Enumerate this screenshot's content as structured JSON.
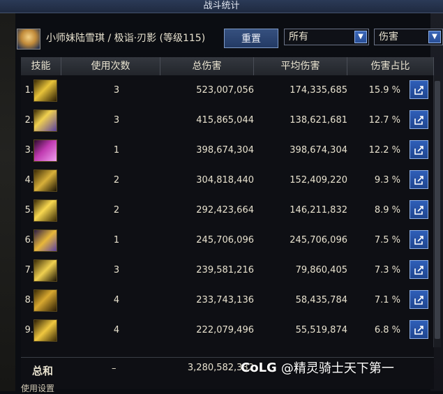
{
  "window": {
    "title": "战斗统计"
  },
  "header": {
    "character": "小师妹陆雪琪 / 极诣·刃影 (等级115)",
    "reset_label": "重置",
    "filter_target": "所有",
    "filter_metric": "伤害"
  },
  "table": {
    "columns": [
      "技能",
      "使用次数",
      "总伤害",
      "平均伤害",
      "伤害占比"
    ],
    "rows": [
      {
        "idx": "1.",
        "uses": "3",
        "total": "523,007,056",
        "avg": "174,335,685",
        "pct": "15.9 %"
      },
      {
        "idx": "2.",
        "uses": "3",
        "total": "415,865,044",
        "avg": "138,621,681",
        "pct": "12.7 %"
      },
      {
        "idx": "3.",
        "uses": "1",
        "total": "398,674,304",
        "avg": "398,674,304",
        "pct": "12.2 %"
      },
      {
        "idx": "4.",
        "uses": "2",
        "total": "304,818,440",
        "avg": "152,409,220",
        "pct": "9.3 %"
      },
      {
        "idx": "5.",
        "uses": "2",
        "total": "292,423,664",
        "avg": "146,211,832",
        "pct": "8.9 %"
      },
      {
        "idx": "6.",
        "uses": "1",
        "total": "245,706,096",
        "avg": "245,706,096",
        "pct": "7.5 %"
      },
      {
        "idx": "7.",
        "uses": "3",
        "total": "239,581,216",
        "avg": "79,860,405",
        "pct": "7.3 %"
      },
      {
        "idx": "8.",
        "uses": "4",
        "total": "233,743,136",
        "avg": "58,435,784",
        "pct": "7.1 %"
      },
      {
        "idx": "9.",
        "uses": "4",
        "total": "222,079,496",
        "avg": "55,519,874",
        "pct": "6.8 %"
      }
    ],
    "total_label": "总和",
    "total_uses": "–",
    "total_value": "3,280,582,332"
  },
  "bottom_tab": "使用设置",
  "watermark": {
    "logo": "CoLG",
    "text": "@精灵骑士天下第一"
  },
  "colors": {
    "accent_blue": "#2f5fb8",
    "title_bar": "#2b3a57",
    "text": "#e8e2cf"
  },
  "icons": [
    "share-icon",
    "dropdown-arrow-icon"
  ]
}
